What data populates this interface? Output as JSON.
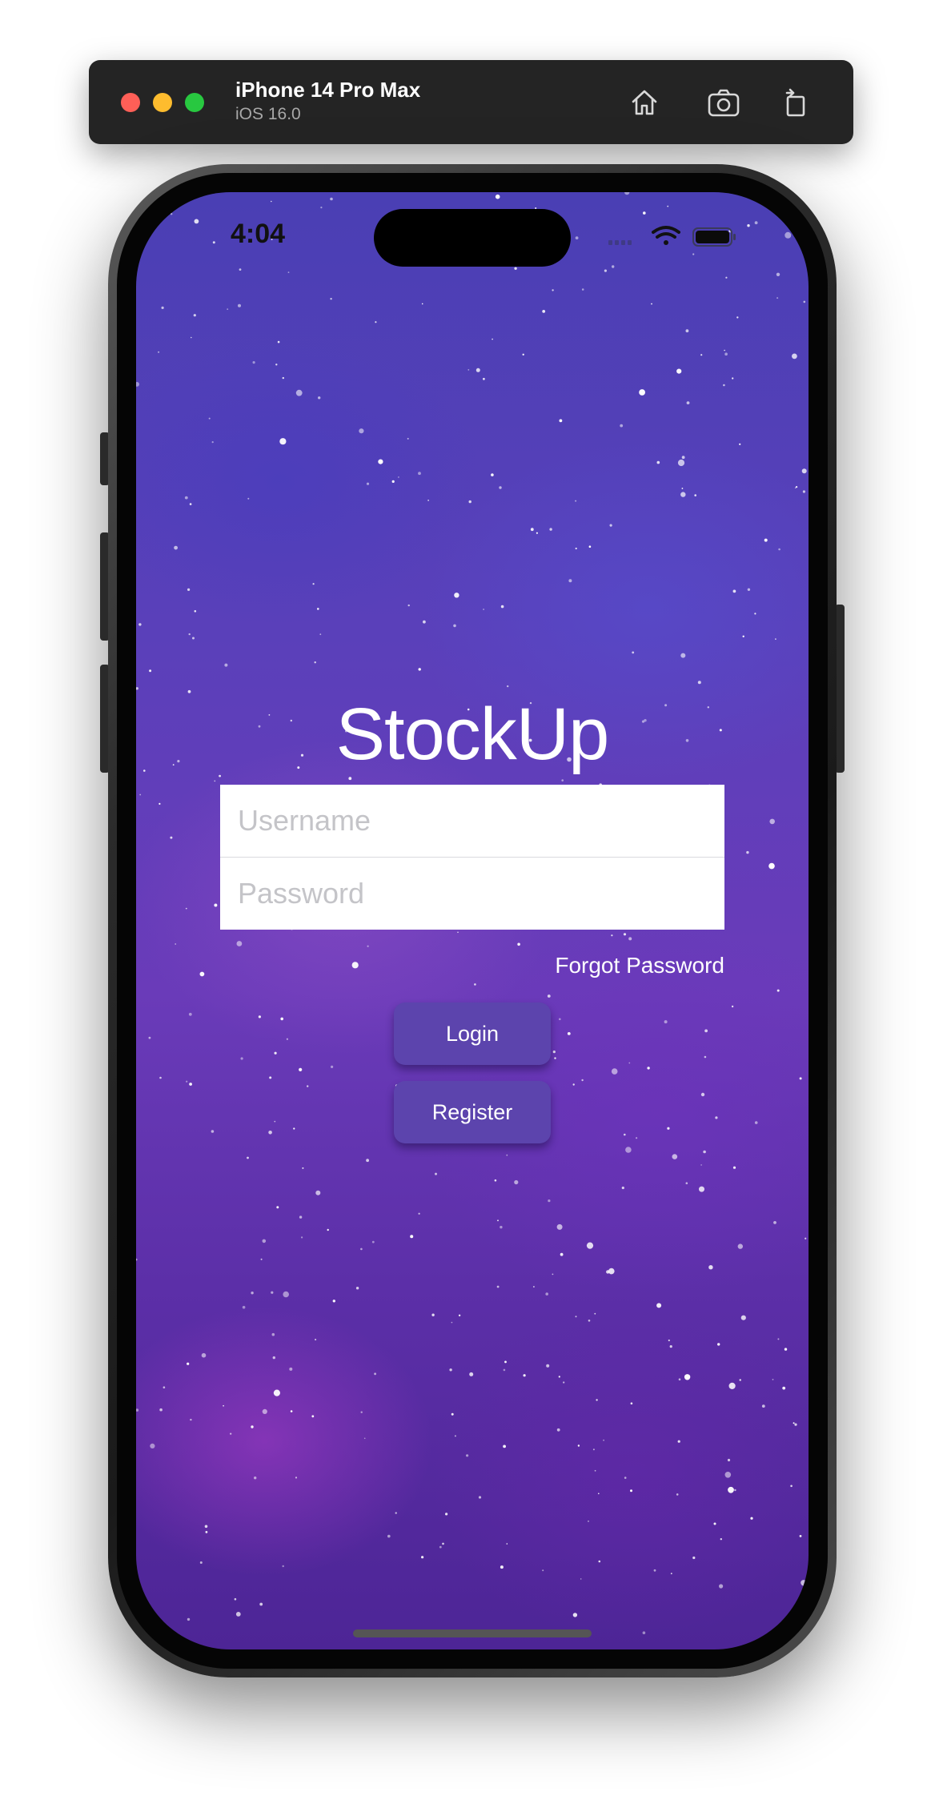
{
  "simulator": {
    "device_name": "iPhone 14 Pro Max",
    "os_version": "iOS 16.0",
    "icons": [
      "home-icon",
      "screenshot-icon",
      "rotate-icon"
    ],
    "traffic_light_colors": [
      "#ff5f57",
      "#febc2e",
      "#28c840"
    ]
  },
  "status_bar": {
    "time": "4:04",
    "icons": [
      "cellular-icon",
      "wifi-icon",
      "battery-icon"
    ]
  },
  "app": {
    "title": "StockUp",
    "username_placeholder": "Username",
    "password_placeholder": "Password",
    "forgot_password_label": "Forgot Password",
    "login_label": "Login",
    "register_label": "Register",
    "button_color": "#5c44ad",
    "background_style": "purple-galaxy"
  }
}
